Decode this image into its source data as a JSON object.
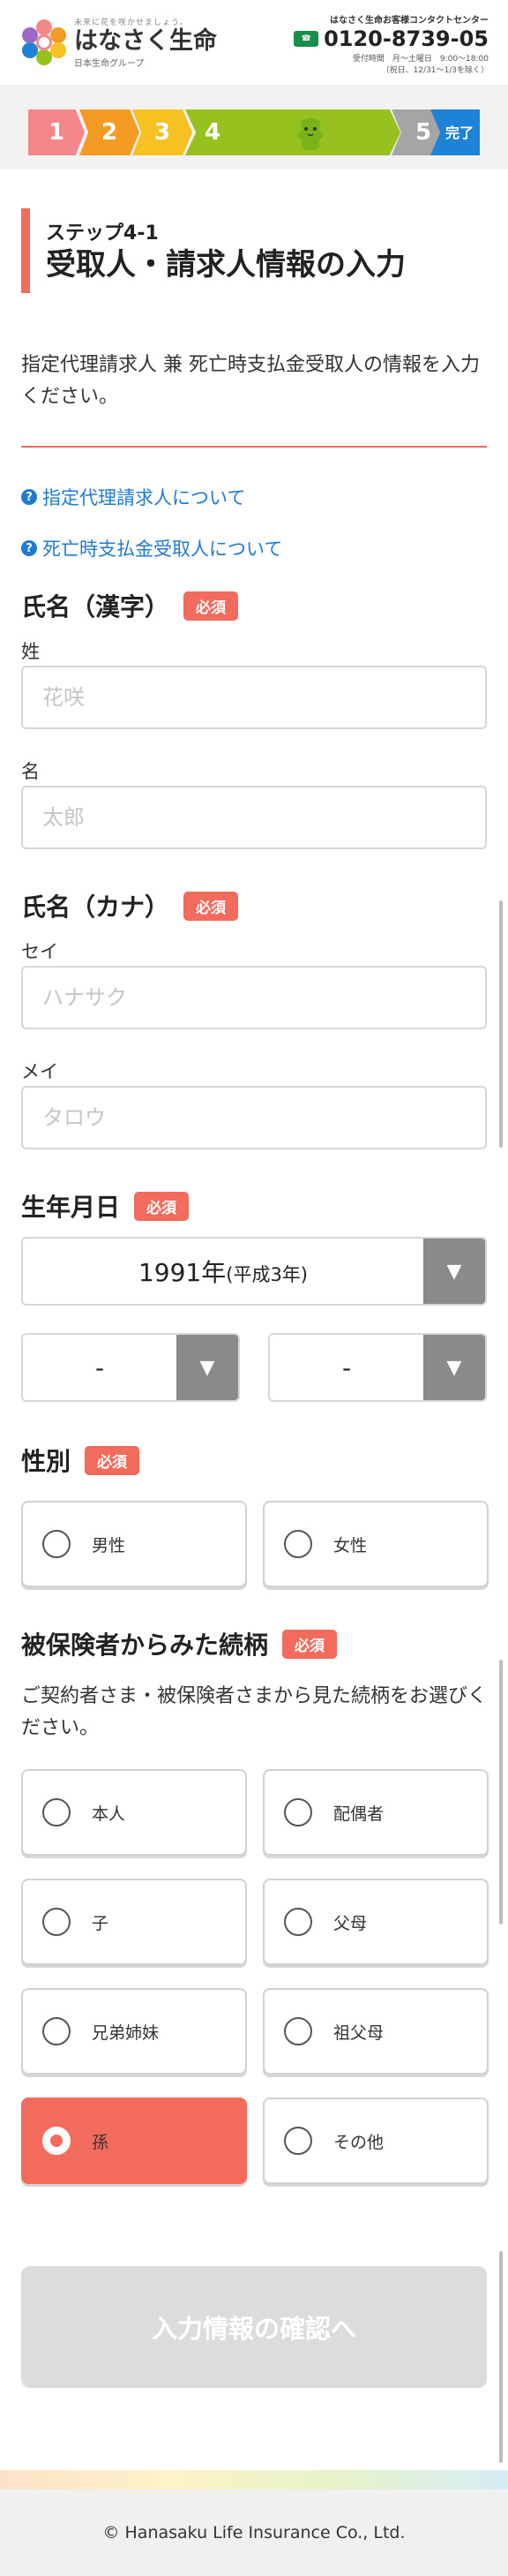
{
  "header": {
    "tagline": "未来に花を咲かせましょう。",
    "brand": "はなさく生命",
    "group": "日本生命グループ",
    "contact_title": "はなさく生命お客様コンタクトセンター",
    "freedial_icon": "freedial-icon",
    "phone": "0120-8739-05",
    "hours": "受付時間　月～土曜日　9:00～18:00",
    "hours_note": "（祝日、12/31～1/3を除く）"
  },
  "progress": {
    "steps": [
      "1",
      "2",
      "3",
      "4",
      "5",
      "完了"
    ],
    "current": 4
  },
  "page": {
    "step_label": "ステップ4-1",
    "title": "受取人・請求人情報の入力",
    "intro": "指定代理請求人 兼 死亡時支払金受取人の情報を入力ください。"
  },
  "help_links": [
    "指定代理請求人について",
    "死亡時支払金受取人について"
  ],
  "required_badge": "必須",
  "name_kanji": {
    "title": "氏名（漢字）",
    "last_label": "姓",
    "last_placeholder": "花咲",
    "first_label": "名",
    "first_placeholder": "太郎"
  },
  "name_kana": {
    "title": "氏名（カナ）",
    "last_label": "セイ",
    "last_placeholder": "ハナサク",
    "first_label": "メイ",
    "first_placeholder": "タロウ"
  },
  "birthdate": {
    "title": "生年月日",
    "year": "1991年",
    "year_era": "(平成3年)",
    "month": "-",
    "day": "-"
  },
  "gender": {
    "title": "性別",
    "options": [
      "男性",
      "女性"
    ]
  },
  "relation": {
    "title": "被保険者からみた続柄",
    "description": "ご契約者さま・被保険者さまから見た続柄をお選びください。",
    "options": [
      "本人",
      "配偶者",
      "子",
      "父母",
      "兄弟姉妹",
      "祖父母",
      "孫",
      "その他"
    ],
    "selected": "孫"
  },
  "confirm_button": "入力情報の確認へ",
  "footer": {
    "copyright": "© Hanasaku Life Insurance Co., Ltd."
  }
}
